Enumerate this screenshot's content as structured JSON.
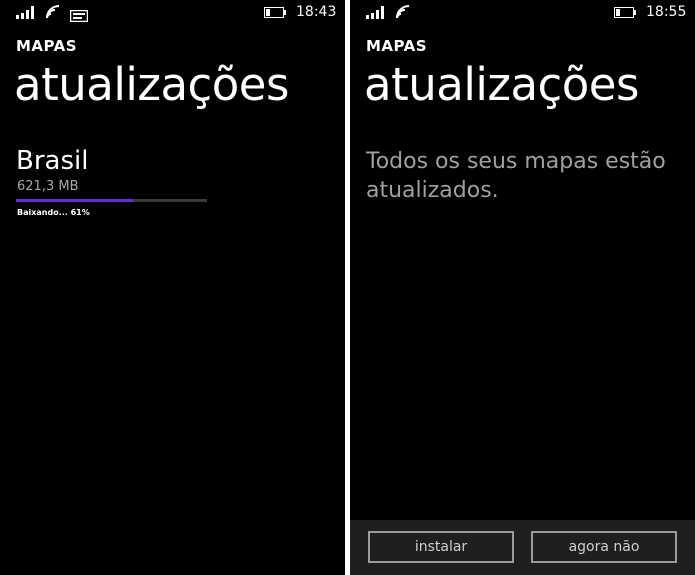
{
  "left_screen": {
    "status_bar": {
      "time": "18:43",
      "icons": [
        "signal-icon",
        "wifi-icon",
        "message-icon",
        "battery-icon"
      ]
    },
    "app_name": "MAPAS",
    "page_title": "atualizações",
    "map_item": {
      "name": "Brasil",
      "size": "621,3 MB",
      "progress_percent": 61,
      "status": "Baixando... 61%"
    },
    "colors": {
      "accent": "#6a2bd6",
      "background": "#000000"
    }
  },
  "right_screen": {
    "status_bar": {
      "time": "18:55",
      "icons": [
        "signal-icon",
        "wifi-icon",
        "battery-icon"
      ]
    },
    "app_name": "MAPAS",
    "page_title": "atualizações",
    "message": "Todos os seus mapas estão atualizados.",
    "app_bar": {
      "install_label": "instalar",
      "not_now_label": "agora não"
    }
  }
}
